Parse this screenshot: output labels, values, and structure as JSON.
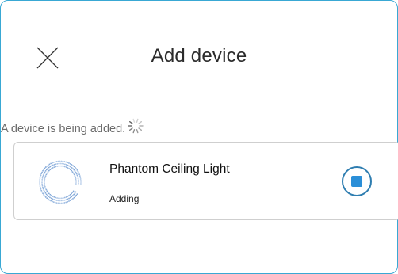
{
  "dialog": {
    "title": "Add device",
    "status_text": "A device is being added.",
    "close_icon": "close-icon",
    "spinner_icon": "loading-spinner-icon"
  },
  "device": {
    "name": "Phantom Ceiling Light",
    "status": "Adding",
    "image_icon": "ceiling-light-ring-icon",
    "stop_icon": "stop-icon"
  },
  "colors": {
    "dialog_border": "#39a8d4",
    "stop_ring": "#2e7db0",
    "stop_fill": "#2b8fd8",
    "device_ring": "#7fa6d8"
  }
}
